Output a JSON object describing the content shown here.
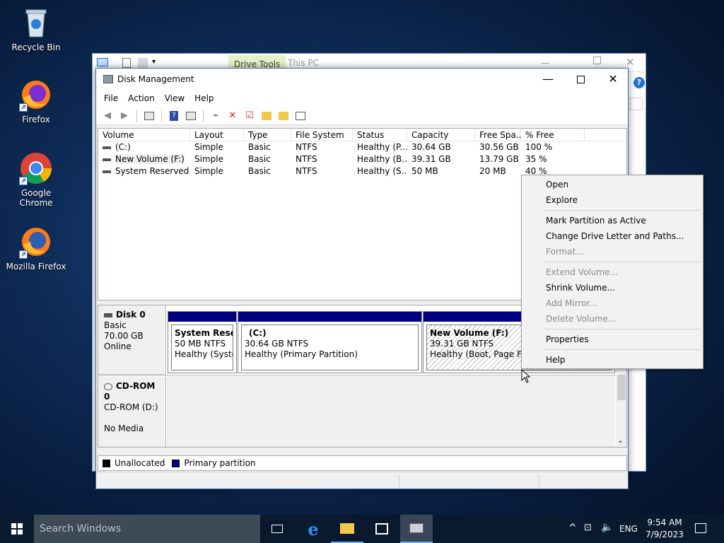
{
  "desktop": {
    "icons": [
      {
        "label": "Recycle Bin"
      },
      {
        "label": "Firefox"
      },
      {
        "label": "Google Chrome"
      },
      {
        "label": "Mozilla Firefox"
      }
    ]
  },
  "explorer": {
    "drive_tools_tab": "Drive Tools",
    "title": "This PC"
  },
  "window": {
    "title": "Disk Management",
    "menu": [
      "File",
      "Action",
      "View",
      "Help"
    ]
  },
  "volume_list": {
    "headers": [
      "Volume",
      "Layout",
      "Type",
      "File System",
      "Status",
      "Capacity",
      "Free Spa...",
      "% Free"
    ],
    "rows": [
      [
        "(C:)",
        "Simple",
        "Basic",
        "NTFS",
        "Healthy (P...",
        "30.64 GB",
        "30.56 GB",
        "100 %"
      ],
      [
        "New Volume (F:)",
        "Simple",
        "Basic",
        "NTFS",
        "Healthy (B...",
        "39.31 GB",
        "13.79 GB",
        "35 %"
      ],
      [
        "System Reserved",
        "Simple",
        "Basic",
        "NTFS",
        "Healthy (S...",
        "50 MB",
        "20 MB",
        "40 %"
      ]
    ]
  },
  "disk0": {
    "name": "Disk 0",
    "type": "Basic",
    "size": "70.00 GB",
    "state": "Online",
    "partitions": [
      {
        "title": "System Reserv",
        "size": "50 MB NTFS",
        "status": "Healthy (System"
      },
      {
        "title": "(C:)",
        "size": "30.64 GB NTFS",
        "status": "Healthy (Primary Partition)"
      },
      {
        "title": "New Volume  (F:)",
        "size": "39.31 GB NTFS",
        "status": "Healthy (Boot, Page File,"
      }
    ]
  },
  "cdrom0": {
    "name": "CD-ROM 0",
    "drive": "CD-ROM (D:)",
    "media": "No Media"
  },
  "legend": {
    "unallocated": "Unallocated",
    "primary": "Primary partition",
    "unallocated_color": "#000000",
    "primary_color": "#000080"
  },
  "context_menu": {
    "items": [
      {
        "label": "Open",
        "enabled": true
      },
      {
        "label": "Explore",
        "enabled": true
      },
      {
        "label": "Mark Partition as Active",
        "enabled": true
      },
      {
        "label": "Change Drive Letter and Paths...",
        "enabled": true
      },
      {
        "label": "Format...",
        "enabled": false
      },
      {
        "label": "Extend Volume...",
        "enabled": false
      },
      {
        "label": "Shrink Volume...",
        "enabled": true
      },
      {
        "label": "Add Mirror...",
        "enabled": false
      },
      {
        "label": "Delete Volume...",
        "enabled": false
      },
      {
        "label": "Properties",
        "enabled": true
      },
      {
        "label": "Help",
        "enabled": true
      }
    ]
  },
  "taskbar": {
    "search_placeholder": "Search Windows",
    "language": "ENG",
    "time": "9:54 AM",
    "date": "7/9/2023"
  }
}
